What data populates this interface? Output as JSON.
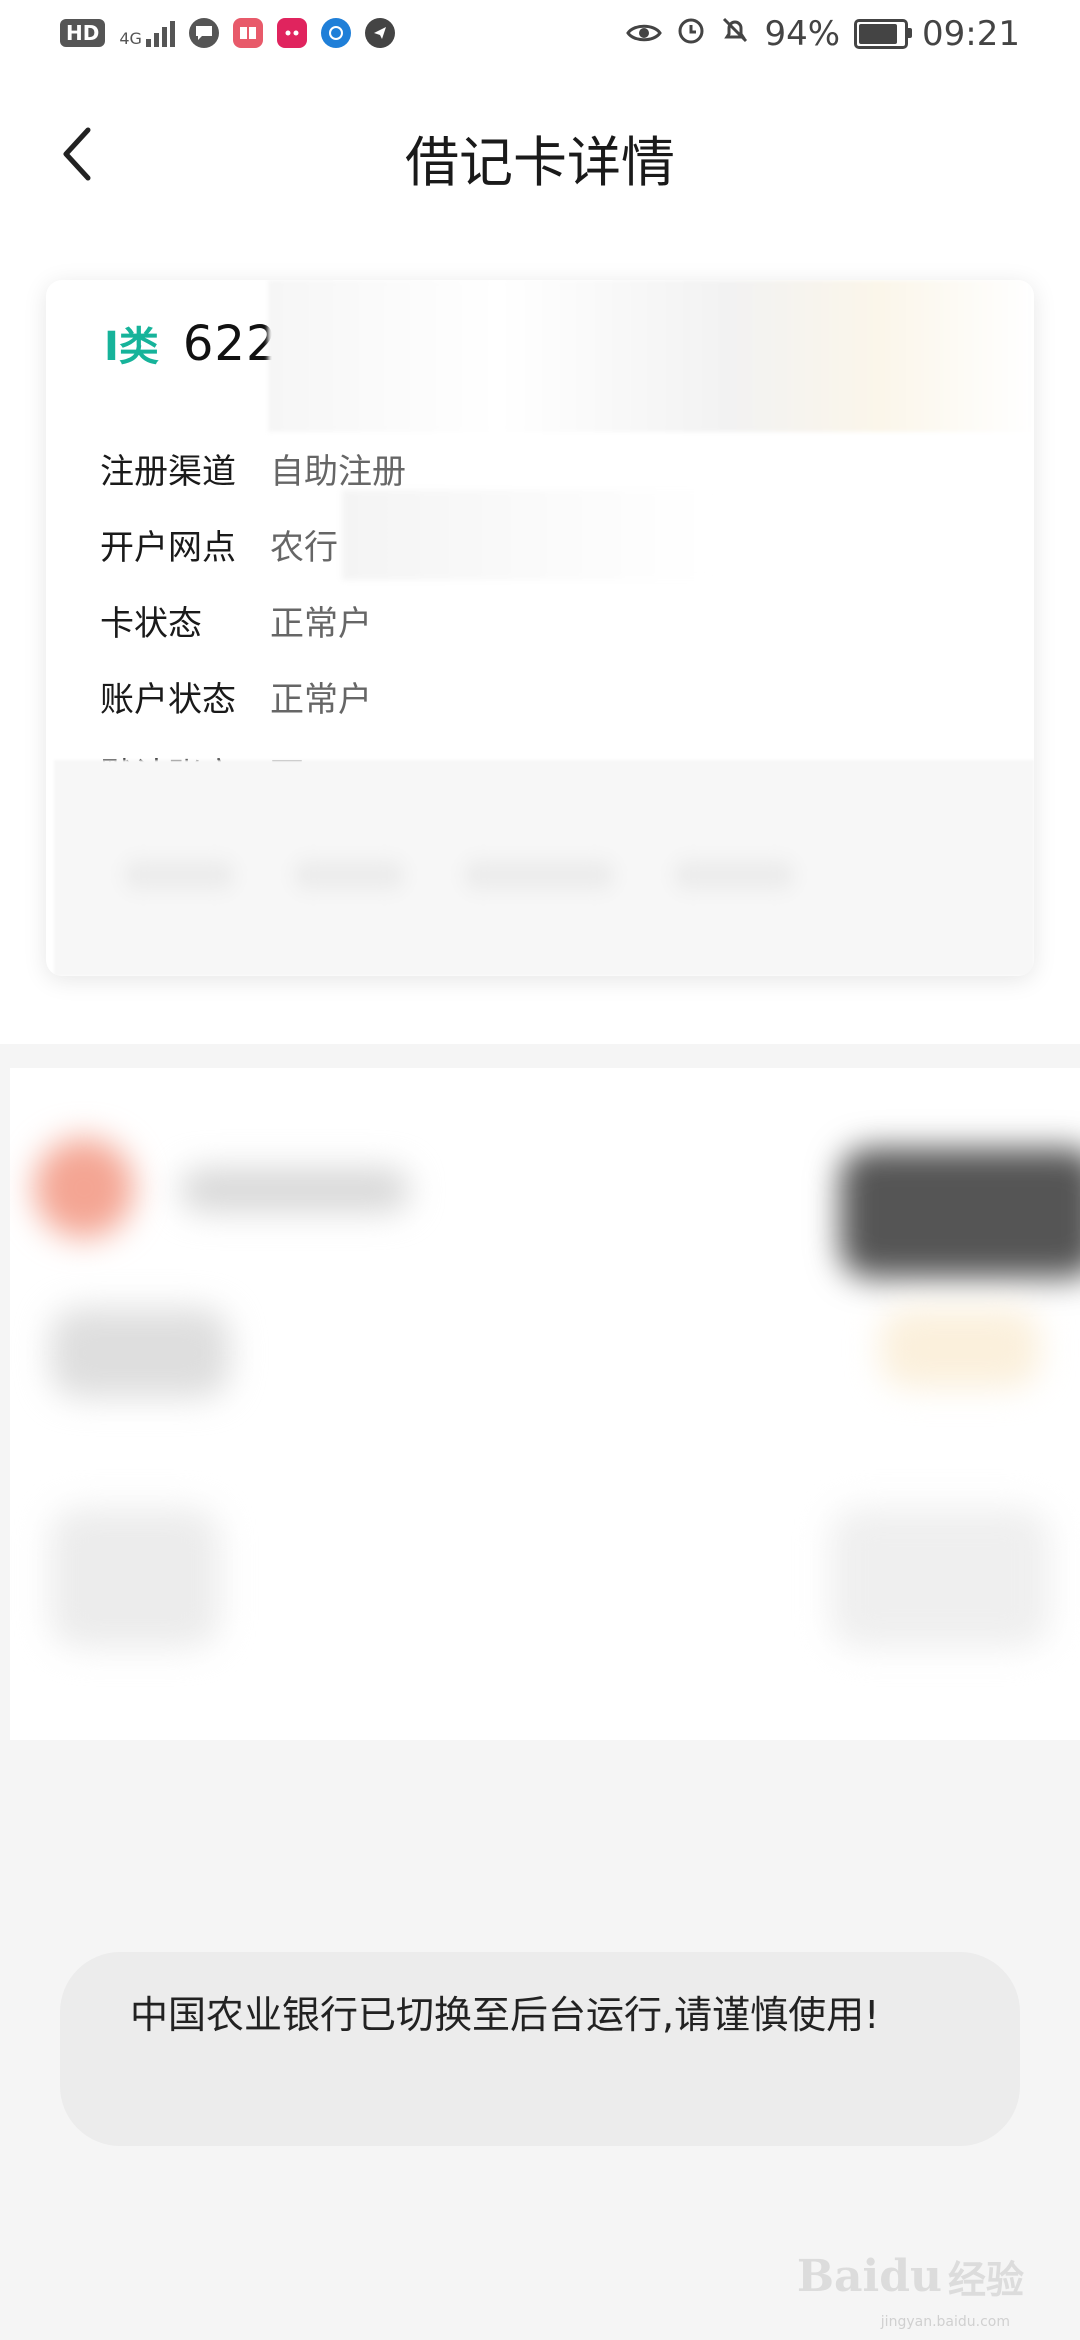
{
  "status_bar": {
    "hd_badge": "HD",
    "network_label": "4G",
    "battery_percent": "94%",
    "battery_level": 0.94,
    "time": "09:21",
    "icons": [
      "hd-icon",
      "signal-4g-icon",
      "message-icon",
      "reader-app-icon",
      "tmall-app-icon",
      "browser-app-icon",
      "send-app-icon",
      "eye-icon",
      "alarm-icon",
      "bell-off-icon",
      "battery-icon"
    ]
  },
  "header": {
    "title": "借记卡详情",
    "back_icon": "chevron-left-icon"
  },
  "card": {
    "type_label": "I类",
    "number_prefix": "622",
    "fields": [
      {
        "label": "注册渠道",
        "value": "自助注册"
      },
      {
        "label": "开户网点",
        "value": "农行"
      },
      {
        "label": "卡状态",
        "value": "正常户"
      },
      {
        "label": "账户状态",
        "value": "正常户"
      },
      {
        "label": "默认账户",
        "value": "否"
      }
    ]
  },
  "toast": {
    "message": "中国农业银行已切换至后台运行,请谨慎使用!"
  },
  "watermark": {
    "logo_text": "Baidu",
    "logo_sub": "经验",
    "url": "jingyan.baidu.com"
  },
  "colors": {
    "accent_teal": "#16b39a",
    "page_bg": "#f5f5f5",
    "card_bg": "#ffffff",
    "toast_bg": "#ececec"
  }
}
